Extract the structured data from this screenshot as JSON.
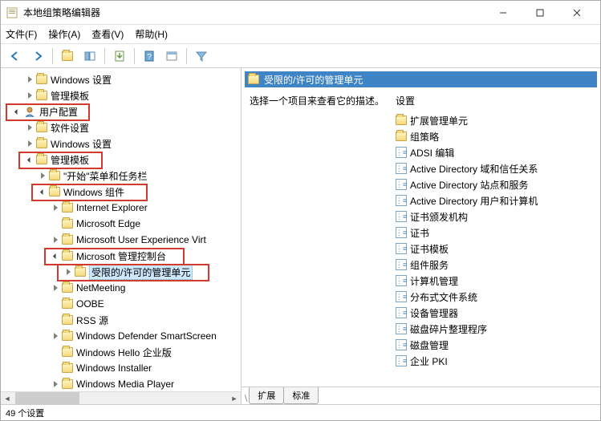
{
  "window": {
    "title": "本地组策略编辑器"
  },
  "menu": {
    "file": "文件(F)",
    "action": "操作(A)",
    "view": "查看(V)",
    "help": "帮助(H)"
  },
  "tree": {
    "n0": "Windows 设置",
    "n1": "管理模板",
    "n2": "用户配置",
    "n3": "软件设置",
    "n4": "Windows 设置",
    "n5": "管理模板",
    "n6": "\"开始\"菜单和任务栏",
    "n7": "Windows 组件",
    "n8": "Internet Explorer",
    "n9": "Microsoft Edge",
    "n10": "Microsoft User Experience Virt",
    "n11": "Microsoft 管理控制台",
    "n12": "受限的/许可的管理单元",
    "n13": "NetMeeting",
    "n14": "OOBE",
    "n15": "RSS 源",
    "n16": "Windows Defender SmartScreen",
    "n17": "Windows Hello 企业版",
    "n18": "Windows Installer",
    "n19": "Windows Media Player"
  },
  "right": {
    "header": "受限的/许可的管理单元",
    "desc": "选择一个项目来查看它的描述。",
    "settings_head": "设置",
    "items": {
      "i0": "扩展管理单元",
      "i1": "组策略",
      "i2": "ADSI 编辑",
      "i3": "Active Directory 域和信任关系",
      "i4": "Active Directory 站点和服务",
      "i5": "Active Directory 用户和计算机",
      "i6": "证书颁发机构",
      "i7": "证书",
      "i8": "证书模板",
      "i9": "组件服务",
      "i10": "计算机管理",
      "i11": "分布式文件系统",
      "i12": "设备管理器",
      "i13": "磁盘碎片整理程序",
      "i14": "磁盘管理",
      "i15": "企业 PKI"
    }
  },
  "tabs": {
    "t0": "扩展",
    "t1": "标准"
  },
  "status": "49 个设置"
}
